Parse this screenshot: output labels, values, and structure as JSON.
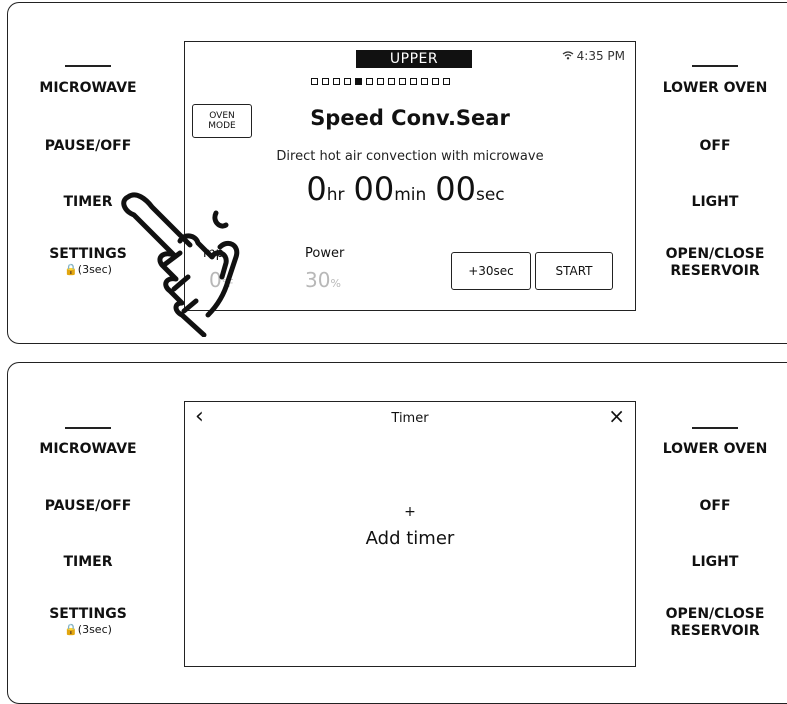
{
  "top_panel": {
    "left_buttons": [
      {
        "label": "MICROWAVE"
      },
      {
        "label": "PAUSE/OFF"
      },
      {
        "label": "TIMER"
      },
      {
        "label": "SETTINGS",
        "sub": "🔒(3sec)"
      }
    ],
    "right_buttons": [
      {
        "label": "LOWER OVEN"
      },
      {
        "label": "OFF"
      },
      {
        "label": "LIGHT"
      },
      {
        "label": "OPEN/CLOSE",
        "label2": "RESERVOIR"
      }
    ],
    "screen": {
      "tab": "UPPER",
      "wifi_icon": "wifi-icon",
      "clock": "4:35 PM",
      "page_dots": 13,
      "active_dot": 4,
      "mode_box": {
        "line1": "OVEN",
        "line2": "MODE"
      },
      "mode_name": "Speed Conv.Sear",
      "description": "Direct hot air convection with microwave",
      "time": {
        "hr": "0",
        "hr_unit": "hr",
        "min": "00",
        "min_unit": "min",
        "sec": "00",
        "sec_unit": "sec"
      },
      "temp_label": "mp.",
      "temp_value": "0",
      "temp_unit": "°F",
      "power_label": "Power",
      "power_value": "30",
      "power_unit": "%",
      "plus30_label": "+30sec",
      "start_label": "START"
    }
  },
  "bottom_panel": {
    "left_buttons": [
      {
        "label": "MICROWAVE"
      },
      {
        "label": "PAUSE/OFF"
      },
      {
        "label": "TIMER"
      },
      {
        "label": "SETTINGS",
        "sub": "🔒(3sec)"
      }
    ],
    "right_buttons": [
      {
        "label": "LOWER OVEN"
      },
      {
        "label": "OFF"
      },
      {
        "label": "LIGHT"
      },
      {
        "label": "OPEN/CLOSE",
        "label2": "RESERVOIR"
      }
    ],
    "screen": {
      "back_icon": "‹",
      "title": "Timer",
      "close_icon": "×",
      "add_plus": "+",
      "add_label": "Add timer"
    }
  }
}
